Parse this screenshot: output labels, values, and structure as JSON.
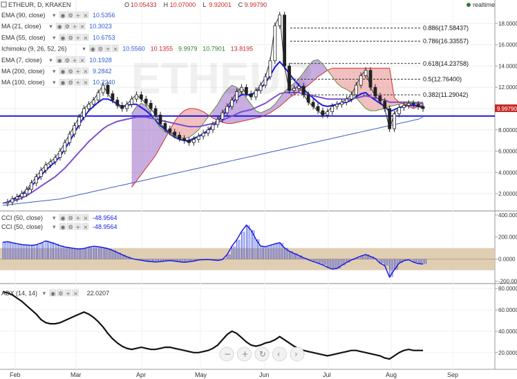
{
  "header": {
    "symbol_title": "ETHEUR, D, KRAKEN",
    "ohlc": [
      {
        "key": "O",
        "value": "10.05433"
      },
      {
        "key": "H",
        "value": "10.07000"
      },
      {
        "key": "L",
        "value": "9.92001"
      },
      {
        "key": "C",
        "value": "9.99790"
      }
    ],
    "realtime_label": "realtime",
    "colors": {
      "up": "#2e7d32",
      "down": "#c62828",
      "text": "#333333",
      "accent": "#1a1ae6"
    }
  },
  "indicators": [
    {
      "label": "EMA (90, close)",
      "values": [
        "10.5356"
      ],
      "colors": [
        "#2b5cd6"
      ]
    },
    {
      "label": "MA (21, close)",
      "values": [
        "10.3023"
      ],
      "colors": [
        "#2b5cd6"
      ]
    },
    {
      "label": "EMA (55, close)",
      "values": [
        "10.6753"
      ],
      "colors": [
        "#2b5cd6"
      ]
    },
    {
      "label": "Ichimoku (9, 26, 52, 26)",
      "values": [
        "10.5560",
        "10.1355",
        "9.9979",
        "10.7901",
        "13.8195"
      ],
      "colors": [
        "#2b5cd6",
        "#c62828",
        "#2e7d32",
        "#2e7d32",
        "#c62828"
      ]
    },
    {
      "label": "EMA (7, close)",
      "values": [
        "10.1928"
      ],
      "colors": [
        "#2b5cd6"
      ]
    },
    {
      "label": "MA (200, close)",
      "values": [
        "9.2842"
      ],
      "colors": [
        "#2b5cd6"
      ]
    },
    {
      "label": "MA (100, close)",
      "values": [
        "10.2240"
      ],
      "colors": [
        "#2b5cd6"
      ]
    }
  ],
  "cci_labels": [
    {
      "label": "CCI (50, close)",
      "value": "-48.9564"
    },
    {
      "label": "CCI (50, close)",
      "value": "-48.9564"
    }
  ],
  "adx": {
    "label": "ADX (14, 14)",
    "value": "22.0207"
  },
  "price_axis": {
    "ticks": [
      "18.0000",
      "16.0000",
      "14.0000",
      "12.0000",
      "10.0000",
      "8.00000",
      "6.00000",
      "4.00000",
      "2.00000"
    ],
    "current": "9.99790"
  },
  "cci_axis": {
    "ticks": [
      "400.0000",
      "200.0000",
      "0.0000",
      "-200.0000"
    ]
  },
  "adx_axis": {
    "ticks": [
      "80.0000",
      "60.0000",
      "40.0000",
      "20.0000"
    ]
  },
  "months": [
    "Feb",
    "Mar",
    "Apr",
    "May",
    "Jun",
    "Jul",
    "Aug",
    "Sep"
  ],
  "fib_levels": [
    {
      "label": "0.886(17.58437)",
      "price": 17.58
    },
    {
      "label": "0.786(16.33557)",
      "price": 16.34
    },
    {
      "label": "0.618(14.23758)",
      "price": 14.24
    },
    {
      "label": "0.5(12.76400)",
      "price": 12.76
    },
    {
      "label": "0.382(11.29042)",
      "price": 11.29
    }
  ],
  "chart_data": {
    "type": "line",
    "price_range": [
      0.7,
      19.3
    ],
    "horizontal_support": 9.3,
    "current_price": 9.9979,
    "series": [
      {
        "name": "ETHEUR",
        "color": "#333333",
        "values": [
          1.1,
          1.2,
          1.5,
          1.7,
          2.0,
          2.4,
          3.0,
          3.6,
          4.2,
          4.7,
          5.0,
          5.4,
          6.0,
          6.8,
          7.6,
          8.4,
          9.2,
          10.0,
          10.4,
          10.8,
          11.5,
          12.2,
          11.4,
          10.8,
          10.3,
          10.0,
          10.4,
          10.9,
          11.3,
          10.9,
          10.5,
          10.0,
          9.4,
          8.6,
          8.1,
          7.8,
          7.5,
          7.2,
          7.0,
          6.8,
          7.1,
          7.4,
          7.7,
          8.0,
          8.5,
          9.0,
          9.6,
          10.2,
          10.8,
          11.6,
          12.0,
          11.4,
          11.1,
          11.7,
          12.2,
          13.0,
          14.5,
          17.8,
          18.8,
          14.0,
          11.7,
          11.9,
          12.1,
          11.3,
          10.6,
          10.2,
          9.8,
          9.4,
          9.7,
          10.2,
          10.4,
          10.6,
          10.9,
          11.3,
          12.2,
          13.1,
          13.6,
          12.0,
          11.2,
          10.7,
          10.0,
          8.1,
          9.5,
          10.1,
          10.3,
          10.5,
          10.4,
          10.2,
          10.0
        ]
      },
      {
        "name": "",
        "color": "#1a1ae6",
        "values": [
          1.1,
          1.2,
          1.4,
          1.6,
          1.9,
          2.2,
          2.7,
          3.2,
          3.7,
          4.2,
          4.6,
          5.0,
          5.5,
          6.2,
          6.9,
          7.7,
          8.5,
          9.2,
          9.8,
          10.2,
          10.6,
          10.9,
          10.9,
          10.7,
          10.4,
          10.2,
          10.3,
          10.4,
          10.4,
          10.1,
          9.8,
          9.4,
          8.9,
          8.4,
          8.0,
          7.6,
          7.3,
          7.1,
          7.0,
          7.0,
          7.2,
          7.4,
          7.6,
          7.9,
          8.3,
          8.8,
          9.3,
          9.9,
          10.5,
          11.0,
          11.3,
          11.3,
          11.3,
          11.6,
          11.9,
          12.4,
          13.1,
          13.9,
          14.4,
          13.9,
          13.3,
          12.7,
          12.2,
          11.8,
          11.4,
          11.0,
          10.6,
          10.3,
          10.2,
          10.3,
          10.4,
          10.5,
          10.6,
          10.8,
          11.1,
          11.4,
          11.5,
          11.1,
          10.8,
          10.5,
          10.2,
          9.7,
          9.9,
          10.1,
          10.2,
          10.3,
          10.3,
          10.2,
          10.2
        ]
      },
      {
        "name": "",
        "color": "#7a4fd1",
        "values": [
          1.1,
          1.2,
          1.3,
          1.4,
          1.6,
          1.8,
          2.1,
          2.4,
          2.7,
          3.0,
          3.3,
          3.6,
          4.0,
          4.4,
          4.9,
          5.4,
          5.9,
          6.4,
          6.9,
          7.3,
          7.7,
          8.1,
          8.4,
          8.6,
          8.8,
          8.9,
          9.0,
          9.1,
          9.2,
          9.2,
          9.2,
          9.1,
          9.0,
          8.9,
          8.8,
          8.7,
          8.6,
          8.5,
          8.4,
          8.3,
          8.3,
          8.3,
          8.4,
          8.5,
          8.6,
          8.7,
          8.9,
          9.1,
          9.3,
          9.5,
          9.7,
          9.8,
          9.9,
          10.1,
          10.3,
          10.5,
          10.8,
          11.1,
          11.4,
          11.5,
          11.5,
          11.5,
          11.5,
          11.4,
          11.3,
          11.2,
          11.1,
          11.0,
          10.9,
          10.9,
          10.9,
          10.9,
          10.9,
          10.9,
          11.0,
          11.1,
          11.2,
          11.1,
          11.0,
          10.9,
          10.8,
          10.6,
          10.6,
          10.6,
          10.6,
          10.6,
          10.6,
          10.5,
          10.5
        ]
      },
      {
        "name": "",
        "color": "#3b5fc0",
        "values": [
          0.9,
          0.95,
          1.0,
          1.05,
          1.1,
          1.15,
          1.2,
          1.25,
          1.3,
          1.35,
          1.4,
          1.45,
          1.5,
          1.6,
          1.7,
          1.8,
          1.9,
          2.0,
          2.1,
          2.2,
          2.3,
          2.4,
          2.5,
          2.6,
          2.7,
          2.8,
          2.9,
          3.0,
          3.1,
          3.2,
          3.3,
          3.4,
          3.5,
          3.6,
          3.7,
          3.8,
          3.9,
          4.0,
          4.1,
          4.2,
          4.3,
          4.4,
          4.5,
          4.6,
          4.7,
          4.8,
          4.9,
          5.0,
          5.1,
          5.2,
          5.3,
          5.4,
          5.5,
          5.6,
          5.7,
          5.8,
          5.9,
          6.0,
          6.1,
          6.2,
          6.3,
          6.4,
          6.5,
          6.6,
          6.7,
          6.8,
          6.9,
          7.0,
          7.1,
          7.2,
          7.3,
          7.4,
          7.5,
          7.6,
          7.7,
          7.8,
          7.9,
          8.0,
          8.1,
          8.2,
          8.3,
          8.4,
          8.5,
          8.6,
          8.7,
          8.8,
          8.9,
          9.0,
          9.2
        ]
      },
      {
        "name": "",
        "color": "#d32f2f",
        "values": [
          null,
          null,
          null,
          null,
          null,
          null,
          null,
          null,
          null,
          null,
          null,
          null,
          null,
          null,
          null,
          null,
          null,
          null,
          null,
          null,
          null,
          null,
          null,
          null,
          null,
          null,
          null,
          2.6,
          3.2,
          3.8,
          4.4,
          5.0,
          5.6,
          6.4,
          7.2,
          8.0,
          8.8,
          9.4,
          9.8,
          10.0,
          10.0,
          9.9,
          9.7,
          9.4,
          9.1,
          8.9,
          8.7,
          8.6,
          8.6,
          8.7,
          8.8,
          8.9,
          9.0,
          9.1,
          9.2,
          9.4,
          9.6,
          9.9,
          10.2,
          10.6,
          11.0,
          11.3,
          11.6,
          11.9,
          12.2,
          12.6,
          13.0,
          13.3,
          13.6,
          13.8,
          13.8,
          13.8,
          13.8,
          13.8,
          13.8,
          13.8,
          13.8,
          13.8,
          13.8,
          13.8,
          13.8,
          13.8,
          11.0,
          10.6,
          10.4,
          10.2,
          10.0,
          10.2,
          10.3
        ]
      },
      {
        "name": "",
        "color": "#5d8f3a",
        "values": [
          null,
          null,
          null,
          null,
          null,
          null,
          null,
          null,
          null,
          null,
          null,
          null,
          null,
          null,
          null,
          null,
          null,
          null,
          null,
          null,
          null,
          null,
          null,
          null,
          null,
          null,
          null,
          9.5,
          10.2,
          10.5,
          10.3,
          9.6,
          8.8,
          8.2,
          7.8,
          7.6,
          7.4,
          7.3,
          7.2,
          7.3,
          7.6,
          8.0,
          8.6,
          9.2,
          9.8,
          10.4,
          11.2,
          11.8,
          12.2,
          12.0,
          11.6,
          11.0,
          10.4,
          9.8,
          9.6,
          9.8,
          10.0,
          10.4,
          11.0,
          11.6,
          12.0,
          12.4,
          12.8,
          13.4,
          14.0,
          14.5,
          14.6,
          14.2,
          13.6,
          13.0,
          12.4,
          12.0,
          11.8,
          11.5,
          11.0,
          10.5,
          10.0,
          9.8,
          9.8,
          9.9,
          10.0,
          10.2,
          10.3,
          10.4,
          10.5,
          10.6,
          10.6,
          10.6,
          10.6
        ]
      },
      {
        "name": "",
        "color": "#111111",
        "values": [
          77,
          76,
          74,
          71,
          68,
          64,
          60,
          56,
          51,
          48,
          47,
          47,
          48,
          50,
          52,
          54,
          56,
          58,
          56,
          53,
          49,
          44,
          38,
          33,
          29,
          26,
          24,
          23,
          24,
          25,
          24,
          23,
          23,
          24,
          25,
          25,
          24,
          23,
          22,
          21,
          20,
          20,
          21,
          22,
          24,
          27,
          32,
          37,
          40,
          38,
          34,
          30,
          27,
          26,
          27,
          29,
          30,
          32,
          35,
          32,
          29,
          26,
          24,
          22,
          21,
          20,
          19,
          18,
          17,
          18,
          19,
          20,
          21,
          22,
          22,
          21,
          20,
          19,
          18,
          17,
          15,
          14,
          17,
          20,
          22,
          23,
          22,
          22,
          22
        ]
      }
    ],
    "cci": [
      152,
      158,
      148,
      140,
      132,
      128,
      125,
      130,
      145,
      165,
      152,
      138,
      122,
      110,
      104,
      96,
      92,
      97,
      108,
      116,
      112,
      105,
      95,
      80,
      60,
      40,
      22,
      6,
      -4,
      -10,
      -18,
      -22,
      -25,
      -23,
      -17,
      -13,
      -18,
      -24,
      -29,
      -24,
      -18,
      -8,
      -5,
      -4,
      -8,
      -12,
      -4,
      42,
      118,
      175,
      250,
      308,
      262,
      180,
      118,
      112,
      125,
      138,
      148,
      102,
      72,
      52,
      33,
      12,
      -6,
      -22,
      -36,
      -52,
      -74,
      -90,
      -84,
      -56,
      -30,
      -8,
      10,
      28,
      42,
      24,
      6,
      -36,
      -60,
      -162,
      -96,
      -36,
      -14,
      -6,
      -28,
      -40,
      -45
    ],
    "cci_band": [
      -100,
      100
    ],
    "adx_range": [
      5,
      84
    ],
    "cci_range": [
      -215,
      430
    ]
  }
}
